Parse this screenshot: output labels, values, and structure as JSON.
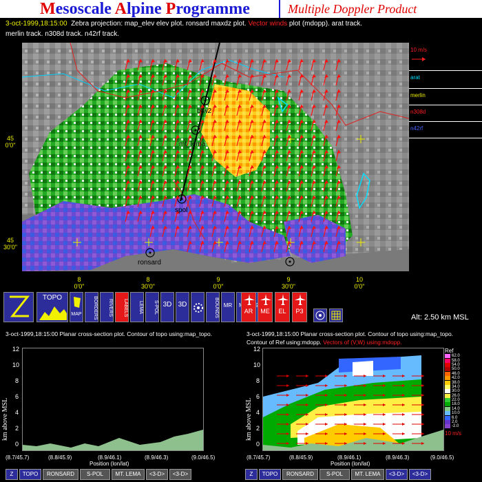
{
  "banner": {
    "title_parts": [
      {
        "cap": "M",
        "rest": "esoscale "
      },
      {
        "cap": "A",
        "rest": "lpine "
      },
      {
        "cap": "P",
        "rest": "rogramme"
      }
    ],
    "subtitle": "Multiple Doppler Product"
  },
  "header": {
    "line1_date": "3-oct-1999,18:15:00",
    "line1_text": "Zebra projection: map_elev elev plot.  ronsard maxdz  plot.",
    "line1_vector": "Vector winds",
    "line1_tail": "plot (mdopp). arat track.",
    "line2_text": "merlin track.  n308d track.  n42rf track."
  },
  "map": {
    "lat_labels": [
      {
        "deg": "45",
        "min": "0'0\""
      },
      {
        "deg": "45",
        "min": "30'0\""
      }
    ],
    "lon_labels": [
      {
        "deg": "8",
        "min": "0'0\""
      },
      {
        "deg": "8",
        "min": "30'0\""
      },
      {
        "deg": "9",
        "min": "0'0\""
      },
      {
        "deg": "9",
        "min": "30'0\""
      },
      {
        "deg": "10",
        "min": "0'0\""
      }
    ],
    "sites": [
      "btw2",
      "mt_lema",
      "spol",
      "ronsard"
    ]
  },
  "side": {
    "scale": "10 m/s",
    "tracks": [
      {
        "label": "arat",
        "color": "#00e0ff"
      },
      {
        "label": "merlin",
        "color": "#f0f000"
      },
      {
        "label": "n308d",
        "color": "#ff2020"
      },
      {
        "label": "n42rf",
        "color": "#4060ff"
      }
    ]
  },
  "toolbar": {
    "topo": "TOPO",
    "map": "MAP",
    "borders": "BORDERS",
    "rivers": "RIVERS",
    "labels": "LABELS",
    "lema": "LEMA",
    "spol": "S-POL",
    "threed1": "3D",
    "threed2": "3D",
    "bounds": "BOUNDS",
    "mr": "MR",
    "ms": "MS",
    "sr": "SR",
    "arat": "AR",
    "merlin": "ME",
    "elec": "EL",
    "p3": "P3"
  },
  "altitude": "Alt: 2.50 km MSL",
  "left_panel": {
    "header1": "3-oct-1999,18:15:00  Planar cross-section plot.  Contour of topo using:map_topo.",
    "ylabel": "km above MSL",
    "yticks": [
      "12",
      "10",
      "8",
      "6",
      "4",
      "2",
      "0"
    ],
    "xticks": [
      "(8.7/45.7)",
      "(8.8/45.9)",
      "(8.9/46.1)",
      "(8.9/46.3)",
      "(9.0/46.5)"
    ],
    "xlabel": "Position (lon/lat)"
  },
  "right_panel": {
    "header1": "3-oct-1999,18:15:00  Planar cross-section plot.  Contour of topo using:map_topo.",
    "header2_a": "Contour of Ref using:mdopp.",
    "header2_b": "Vectors of (V,W) using:mdopp.",
    "ylabel": "km above MSL",
    "yticks": [
      "12",
      "10",
      "8",
      "6",
      "4",
      "2",
      "0"
    ],
    "xticks": [
      "(8.7/45.7)",
      "(8.8/45.9)",
      "(8.9/46.1)",
      "(8.9/46.3)",
      "(9.0/46.5)"
    ],
    "xlabel": "Position (lon/lat)",
    "legend_title": "Ref",
    "legend_values": [
      "62.0",
      "58.0",
      "54.0",
      "50.0",
      "46.0",
      "42.0",
      "38.0",
      "34.0",
      "30.0",
      "26.0",
      "22.0",
      "18.0",
      "14.0",
      "10.0",
      "6.0",
      "2.0",
      "-2.0"
    ],
    "legend_colors": [
      "#ff66ff",
      "#ff0066",
      "#e00000",
      "#b00000",
      "#ff6600",
      "#ff9900",
      "#ffcc00",
      "#ffff66",
      "#ffffff",
      "#ffee44",
      "#33cc33",
      "#00aa00",
      "#88cc88",
      "#66bbff",
      "#3366ff",
      "#6633cc",
      "#8844cc"
    ],
    "scale": "10 m/s"
  },
  "bottom_left_buttons": [
    "Z",
    "TOPO",
    "RONSARD",
    "S-POL",
    "MT. LEMA",
    "<3-D>",
    "<3-D>"
  ],
  "bottom_right_buttons": [
    "Z",
    "TOPO",
    "RONSARD",
    "S-POL",
    "MT. LEMA",
    "<3-D>",
    "<3-D>"
  ]
}
